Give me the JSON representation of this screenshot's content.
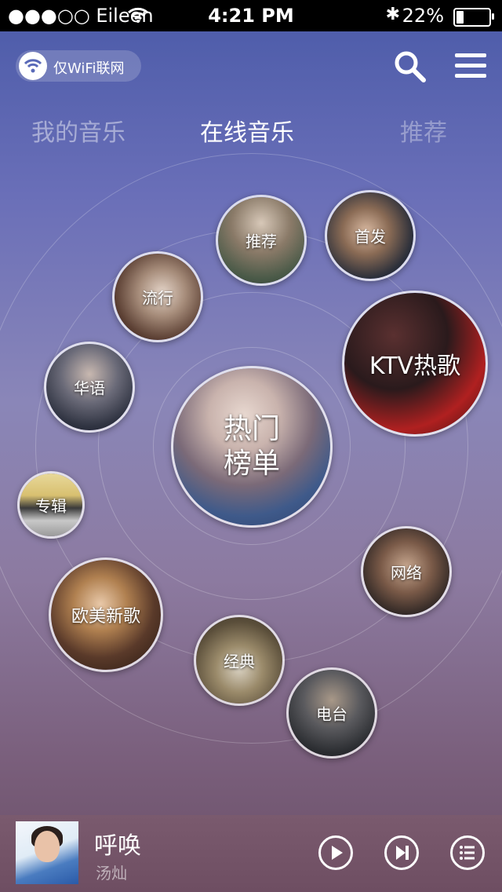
{
  "status_bar": {
    "carrier": "●●●○○ Eileen",
    "time": "4:21 PM",
    "battery": "22%",
    "battery_level": 0.22
  },
  "header": {
    "wifi_label": "仅WiFi联网"
  },
  "tabs": [
    {
      "label": "我的音乐"
    },
    {
      "label": "在线音乐"
    },
    {
      "label": "推荐"
    }
  ],
  "categories": {
    "hot_chart_line1": "热门",
    "hot_chart_line2": "榜单",
    "ktv": "KTV热歌",
    "recommend": "推荐",
    "new_release": "首发",
    "popular": "流行",
    "chinese": "华语",
    "album": "专辑",
    "western": "欧美新歌",
    "classic": "经典",
    "network": "网络",
    "radio": "电台"
  },
  "player": {
    "song": "呼唤",
    "artist": "汤灿"
  },
  "colors": {
    "status_bar": "#000000",
    "accent_white": "#ffffff"
  }
}
